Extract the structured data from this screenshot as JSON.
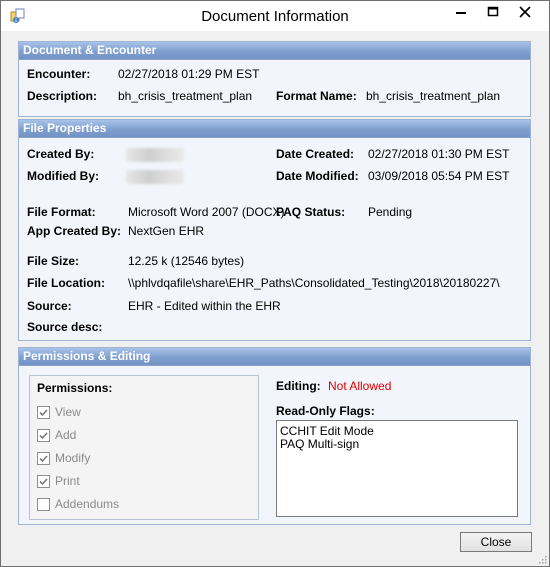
{
  "window": {
    "title": "Document Information"
  },
  "document_encounter": {
    "heading": "Document & Encounter",
    "encounter_label": "Encounter:",
    "encounter_value": "02/27/2018 01:29 PM EST",
    "description_label": "Description:",
    "description_value": "bh_crisis_treatment_plan",
    "format_name_label": "Format Name:",
    "format_name_value": "bh_crisis_treatment_plan"
  },
  "file_properties": {
    "heading": "File Properties",
    "created_by_label": "Created By:",
    "modified_by_label": "Modified By:",
    "date_created_label": "Date Created:",
    "date_created_value": "02/27/2018 01:30 PM EST",
    "date_modified_label": "Date Modified:",
    "date_modified_value": "03/09/2018 05:54 PM EST",
    "file_format_label": "File Format:",
    "file_format_value": "Microsoft Word 2007 (DOCX)",
    "paq_status_label": "PAQ Status:",
    "paq_status_value": "Pending",
    "app_created_by_label": "App Created By:",
    "app_created_by_value": "NextGen EHR",
    "file_size_label": "File Size:",
    "file_size_value": "12.25 k (12546 bytes)",
    "file_location_label": "File Location:",
    "file_location_value": "\\\\phlvdqafile\\share\\EHR_Paths\\Consolidated_Testing\\2018\\20180227\\",
    "source_label": "Source:",
    "source_value": "EHR - Edited within the EHR",
    "source_desc_label": "Source desc:"
  },
  "permissions_editing": {
    "heading": "Permissions & Editing",
    "permissions_label": "Permissions:",
    "permissions": [
      {
        "label": "View",
        "checked": true
      },
      {
        "label": "Add",
        "checked": true
      },
      {
        "label": "Modify",
        "checked": true
      },
      {
        "label": "Print",
        "checked": true
      },
      {
        "label": "Addendums",
        "checked": false
      }
    ],
    "editing_label": "Editing:",
    "editing_value": "Not Allowed",
    "editing_color": "#e00000",
    "read_only_flags_label": "Read-Only Flags:",
    "read_only_flags": [
      "CCHIT Edit Mode",
      "PAQ Multi-sign"
    ]
  },
  "footer": {
    "close_label": "Close"
  },
  "icons": {
    "app": "document-info-icon",
    "minimize": "minimize-icon",
    "maximize": "maximize-icon",
    "close": "close-icon"
  }
}
